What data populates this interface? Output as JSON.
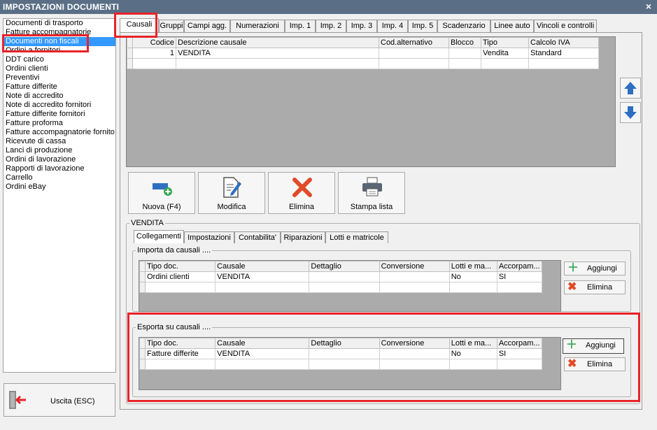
{
  "window": {
    "title": "IMPOSTAZIONI DOCUMENTI",
    "close": "×"
  },
  "doc_list": [
    "Documenti di trasporto",
    "Fatture accompagnatorie",
    "Documenti non fiscali",
    "Ordini a fornitori",
    "DDT carico",
    "Ordini clienti",
    "Preventivi",
    "Fatture differite",
    "Note di accredito",
    "Note di accredito fornitori",
    "Fatture differite fornitori",
    "Fatture proforma",
    "Fatture accompagnatorie fornito",
    "Ricevute di cassa",
    "Lanci di produzione",
    "Ordini di lavorazione",
    "Rapporti di lavorazione",
    "Carrello",
    "Ordini eBay"
  ],
  "selected_doc": "Documenti non fiscali",
  "exit_label": "Uscita (ESC)",
  "tabs": [
    "Causali",
    "Gruppi",
    "Campi agg.",
    "Numerazioni",
    "Imp. 1",
    "Imp. 2",
    "Imp. 3",
    "Imp. 4",
    "Imp. 5",
    "Scadenzario",
    "Linee auto",
    "Vincoli e controlli"
  ],
  "causali_grid": {
    "headers": [
      "Codice",
      "Descrizione causale",
      "Cod.alternativo",
      "Blocco",
      "Tipo",
      "Calcolo IVA"
    ],
    "rows": [
      [
        "1",
        "VENDITA",
        "",
        "",
        "Vendita",
        "Standard"
      ]
    ]
  },
  "buttons": {
    "nuova": "Nuova (F4)",
    "modifica": "Modifica",
    "elimina": "Elimina",
    "stampa": "Stampa lista"
  },
  "detail": {
    "legend": "VENDITA",
    "subtabs": [
      "Collegamenti",
      "Impostazioni",
      "Contabilita'",
      "Riparazioni",
      "Lotti e matricole"
    ],
    "importa": {
      "legend": "Importa da causali ....",
      "headers": [
        "Tipo doc.",
        "Causale",
        "Dettaglio",
        "Conversione",
        "Lotti e ma...",
        "Accorpam..."
      ],
      "rows": [
        [
          "Ordini clienti",
          "VENDITA",
          "",
          "",
          "No",
          "SI"
        ]
      ],
      "add_label": "Aggiungi",
      "del_label": "Elimina"
    },
    "esporta": {
      "legend": "Esporta su causali ....",
      "headers": [
        "Tipo doc.",
        "Causale",
        "Dettaglio",
        "Conversione",
        "Lotti e ma...",
        "Accorpam..."
      ],
      "rows": [
        [
          "Fatture differite",
          "VENDITA",
          "",
          "",
          "No",
          "SI"
        ]
      ],
      "add_label": "Aggiungi",
      "del_label": "Elimina"
    }
  },
  "colors": {
    "highlight": "#e8232a",
    "selection": "#3399ff",
    "title_bar": "#5a6f86"
  }
}
